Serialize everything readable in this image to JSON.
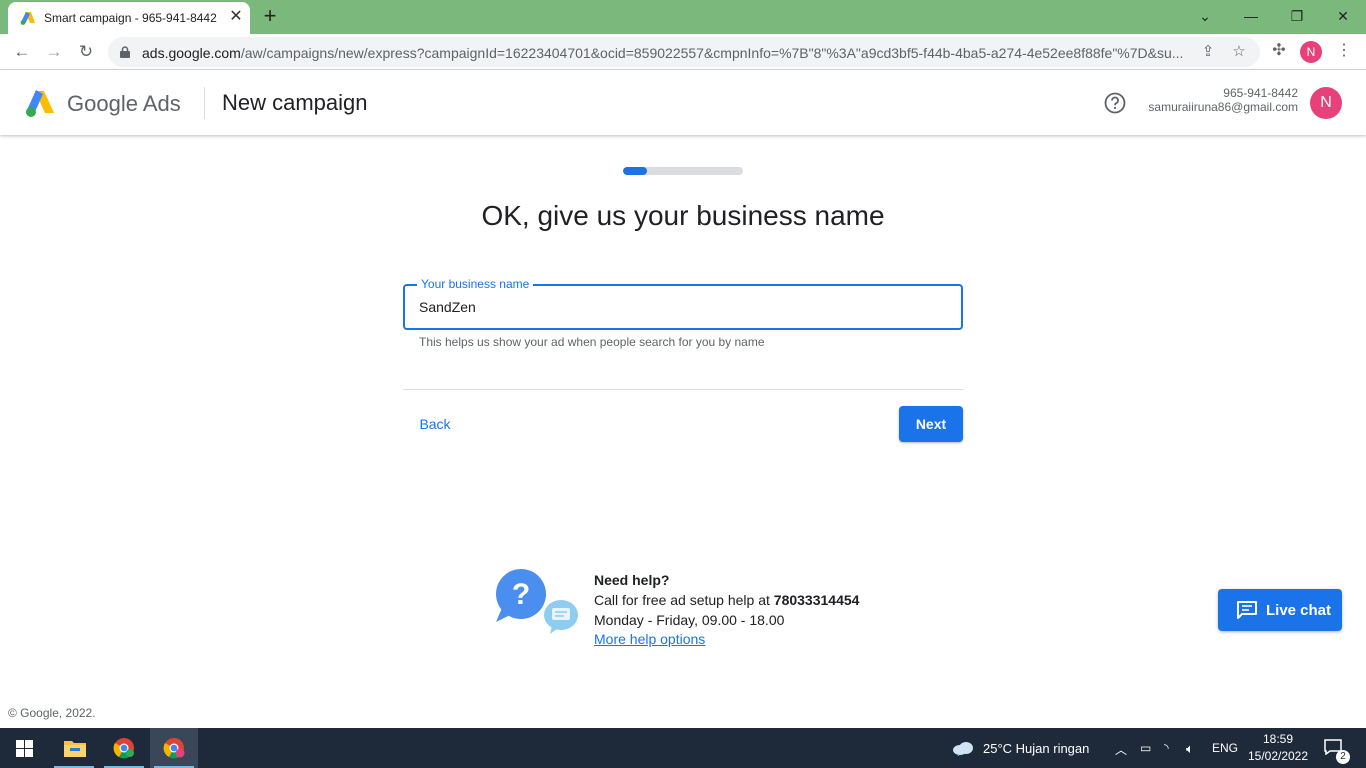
{
  "browser": {
    "tab_title": "Smart campaign - 965-941-8442",
    "url_host": "ads.google.com",
    "url_path": "/aw/campaigns/new/express?campaignId=16223404701&ocid=859022557&cmpnInfo=%7B\"8\"%3A\"a9cd3bf5-f44b-4ba5-a274-4e52ee8f88fe\"%7D&su...",
    "profile_initial": "N",
    "icons": [
      "back-icon",
      "forward-icon",
      "reload-icon",
      "lock-icon",
      "share-icon",
      "star-icon",
      "extensions-icon",
      "menu-icon"
    ]
  },
  "header": {
    "product_name": "Google Ads",
    "page_title": "New campaign",
    "account_id": "965-941-8442",
    "account_email": "samuraiiruna86@gmail.com",
    "avatar_initial": "N"
  },
  "main": {
    "progress_fraction": 0.2,
    "heading": "OK, give us your business name",
    "field_label": "Your business name",
    "field_value": "SandZen",
    "field_hint": "This helps us show your ad when people search for you by name",
    "back_label": "Back",
    "next_label": "Next"
  },
  "help": {
    "title": "Need help?",
    "call_text": "Call for free ad setup help at ",
    "phone": "78033314454",
    "hours": "Monday - Friday, 09.00 - 18.00",
    "link_text": "More help options"
  },
  "live_chat": {
    "label": "Live chat"
  },
  "footer": {
    "copyright": "© Google, 2022."
  },
  "taskbar": {
    "weather": "25°C  Hujan ringan",
    "language": "ENG",
    "time": "18:59",
    "date": "15/02/2022",
    "notification_count": "2"
  },
  "colors": {
    "accent": "#1a73e8",
    "tab_strip": "#7ab87c",
    "avatar": "#e8417a",
    "taskbar": "#1e2a3a"
  }
}
